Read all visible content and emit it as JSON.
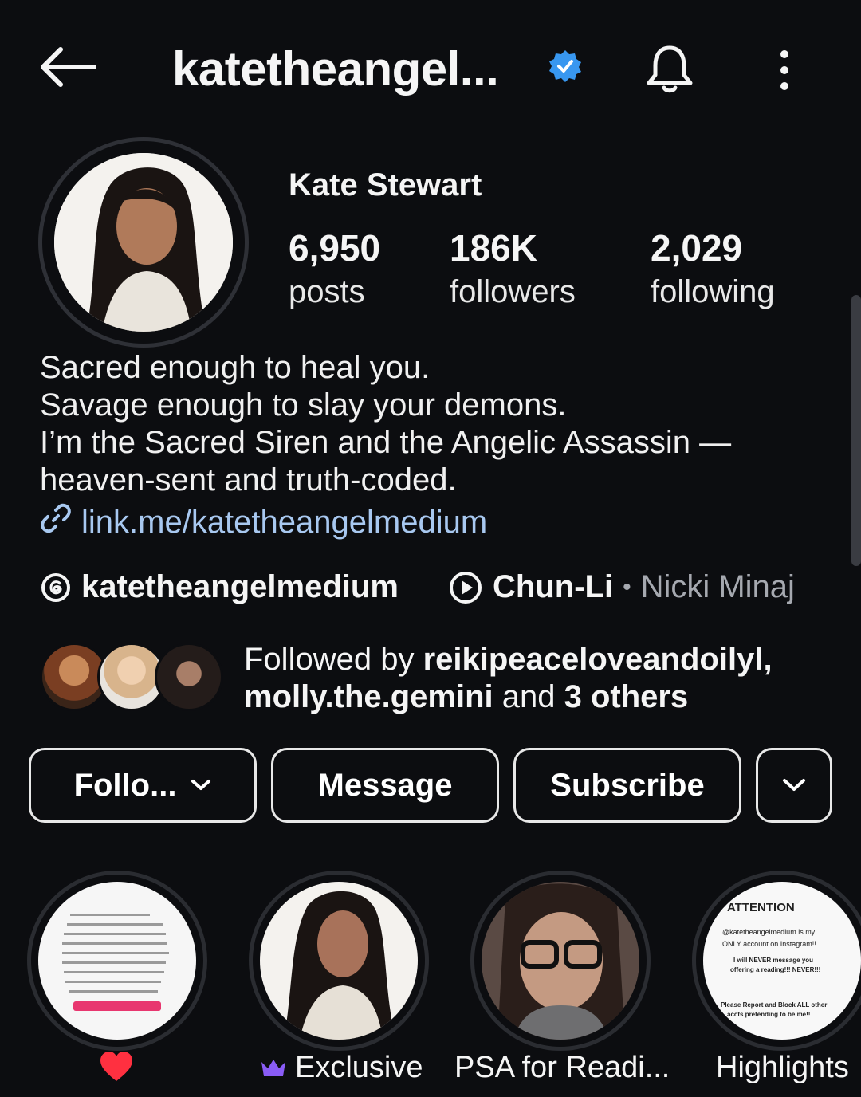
{
  "header": {
    "username": "katetheangel...",
    "icons": [
      "back-arrow-icon",
      "verified-badge-icon",
      "bell-icon",
      "more-vertical-icon"
    ]
  },
  "profile": {
    "name": "Kate Stewart",
    "stats": [
      {
        "value": "6,950",
        "label": "posts"
      },
      {
        "value": "186K",
        "label": "followers"
      },
      {
        "value": "2,029",
        "label": "following"
      }
    ]
  },
  "bio": {
    "lines": [
      "Sacred enough to heal you.",
      "Savage enough to slay your demons.",
      "I’m the Sacred Siren and the Angelic Assassin —",
      "heaven-sent and truth-coded."
    ],
    "link": "link.me/katetheangelmedium"
  },
  "threads": {
    "handle": "katetheangelmedium"
  },
  "music": {
    "song": "Chun-Li",
    "separator": "•",
    "artist": "Nicki Minaj"
  },
  "followed_by": {
    "prefix": "Followed by ",
    "user1": "reikipeaceloveandoilyl,",
    "user2": "molly.the.gemini",
    "middle": " and ",
    "others": "3 others"
  },
  "buttons": {
    "follow": "Follo...",
    "message": "Message",
    "subscribe": "Subscribe"
  },
  "highlights": [
    {
      "label": "",
      "icon": "heart-icon"
    },
    {
      "label": "Exclusive",
      "icon": "crown-icon"
    },
    {
      "label": "PSA for Readi...",
      "icon": ""
    },
    {
      "label": "Highlights",
      "icon": ""
    }
  ],
  "highlight_attention": {
    "heading": "ATTENTION",
    "line1": "@katetheangelmedium is my",
    "line2": "ONLY account on Instagram!!",
    "line3": "I will NEVER message you",
    "line4": "offering a reading!!! NEVER!!!",
    "line5": "Please Report and Block ALL other",
    "line6": "accts pretending to be me!!"
  },
  "colors": {
    "background": "#0c0d10",
    "link": "#a8c8f0",
    "verified": "#3897f0",
    "heart": "#ff3040",
    "crown": "#8a5cf6"
  }
}
